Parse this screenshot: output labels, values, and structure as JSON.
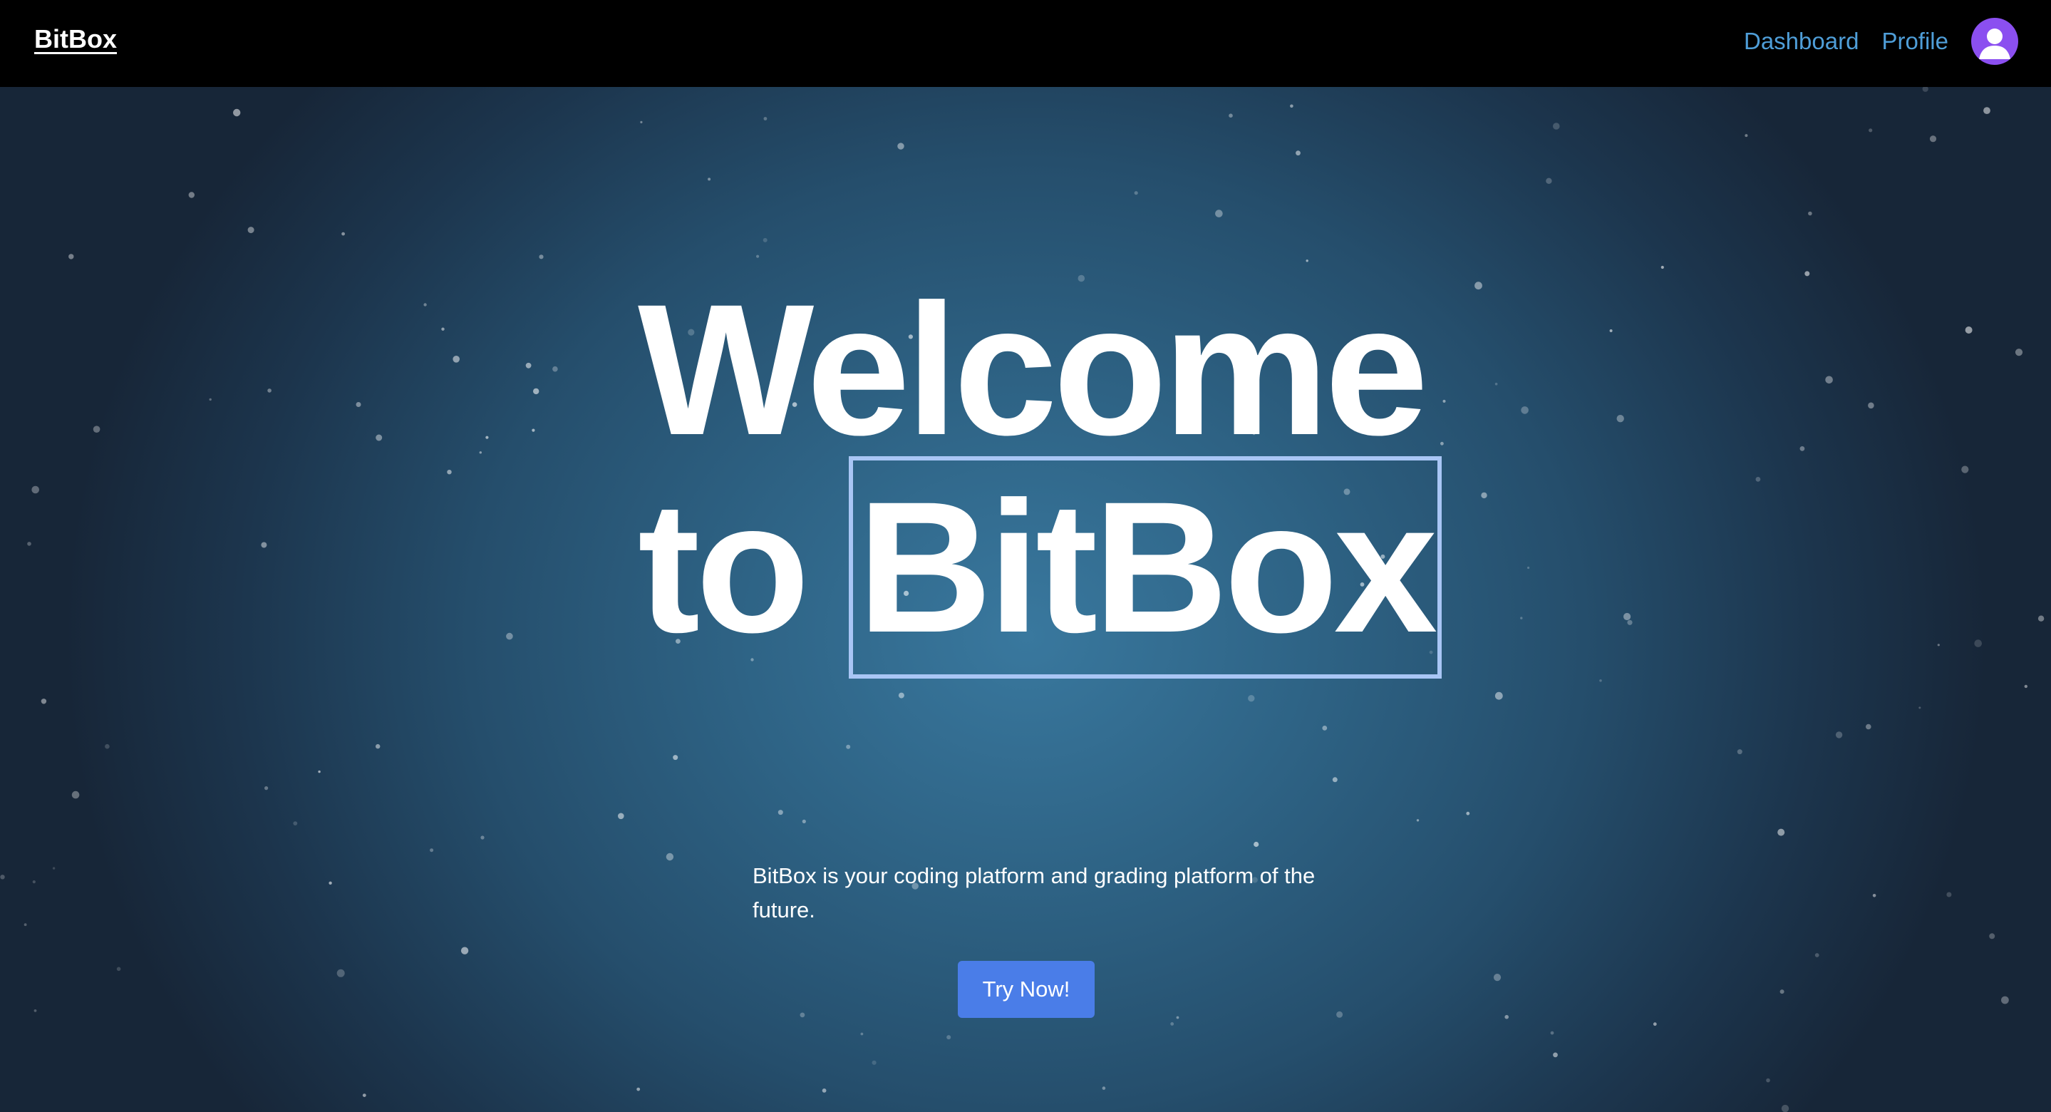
{
  "navbar": {
    "brand": "BitBox",
    "links": {
      "dashboard": "Dashboard",
      "profile": "Profile"
    },
    "avatar_icon": "user-avatar-icon"
  },
  "hero": {
    "heading_line1": "Welcome",
    "heading_line2_prefix": "to",
    "heading_line2_highlight": "BitBox",
    "description": "BitBox is your coding platform and grading platform of the future.",
    "cta_label": "Try Now!"
  },
  "colors": {
    "navbar_bg": "#000000",
    "nav_link": "#4f9ed8",
    "avatar_bg": "#8b4ff0",
    "cta_bg": "#4a7de8",
    "highlight_outline": "#a9c6f5",
    "hero_center": "#39789e",
    "hero_edge": "#172638"
  }
}
